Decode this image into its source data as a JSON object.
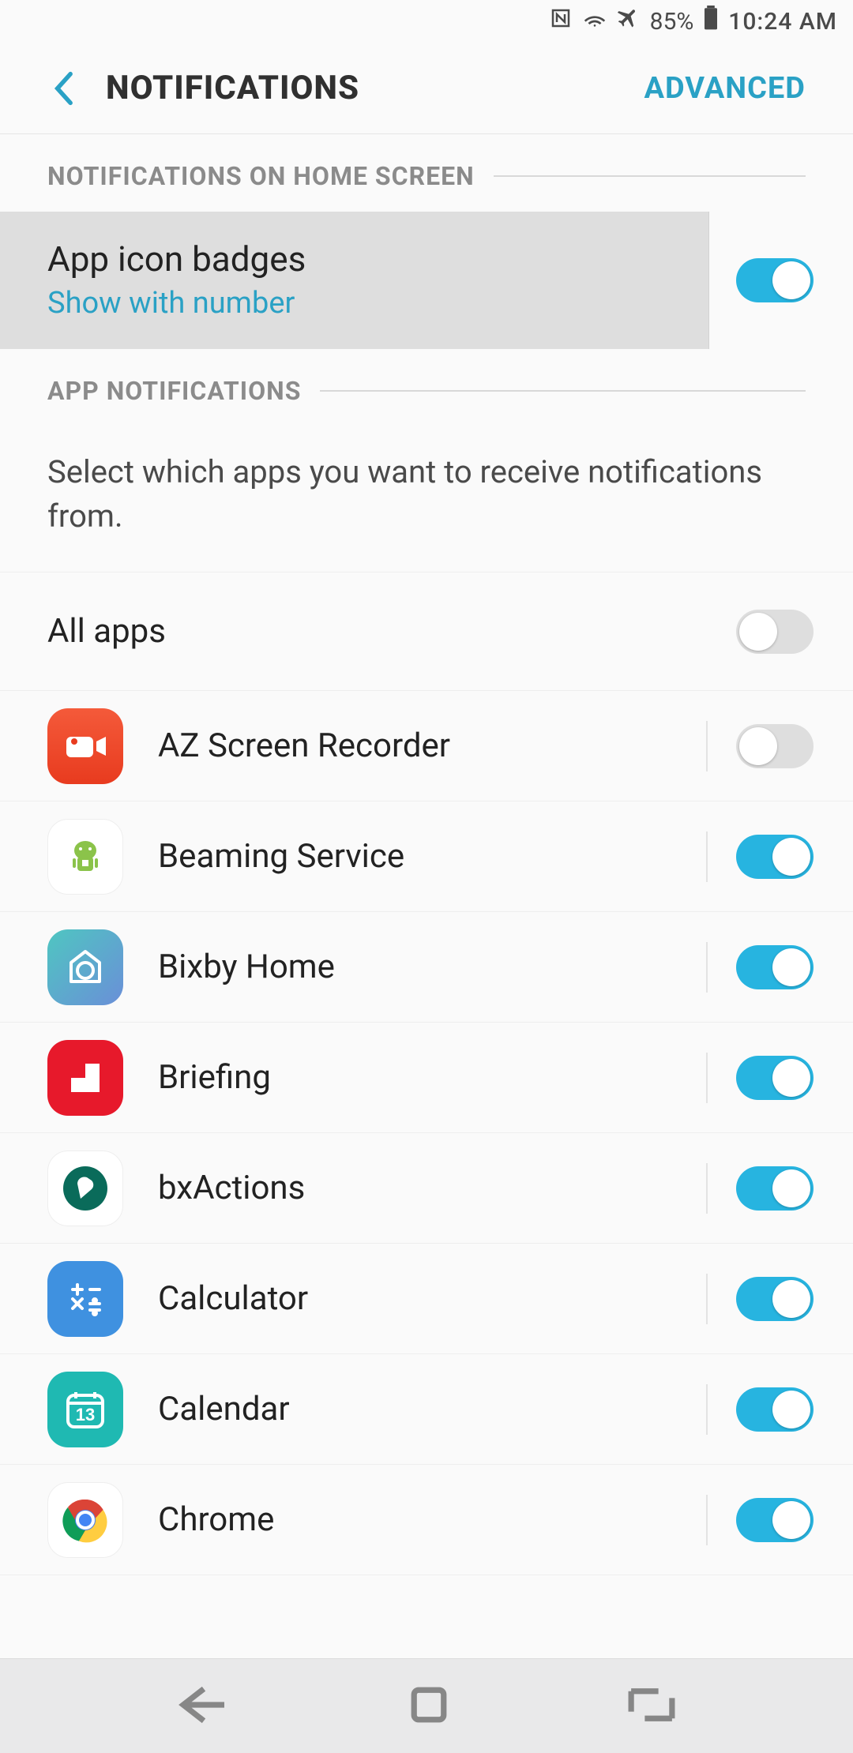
{
  "status": {
    "battery": "85%",
    "time": "10:24 AM"
  },
  "header": {
    "title": "NOTIFICATIONS",
    "advanced": "ADVANCED"
  },
  "sections": {
    "home": "NOTIFICATIONS ON HOME SCREEN",
    "app": "APP NOTIFICATIONS"
  },
  "badges": {
    "title": "App icon badges",
    "subtitle": "Show with number",
    "enabled": true
  },
  "helper": "Select which apps you want to receive notifications from.",
  "all_apps": {
    "label": "All apps",
    "enabled": false
  },
  "apps": [
    {
      "name": "AZ Screen Recorder",
      "enabled": false,
      "icon": "az"
    },
    {
      "name": "Beaming Service",
      "enabled": true,
      "icon": "beam"
    },
    {
      "name": "Bixby Home",
      "enabled": true,
      "icon": "bixby"
    },
    {
      "name": "Briefing",
      "enabled": true,
      "icon": "brief"
    },
    {
      "name": "bxActions",
      "enabled": true,
      "icon": "bx"
    },
    {
      "name": "Calculator",
      "enabled": true,
      "icon": "calc"
    },
    {
      "name": "Calendar",
      "enabled": true,
      "icon": "cal"
    },
    {
      "name": "Chrome",
      "enabled": true,
      "icon": "chrome"
    }
  ]
}
